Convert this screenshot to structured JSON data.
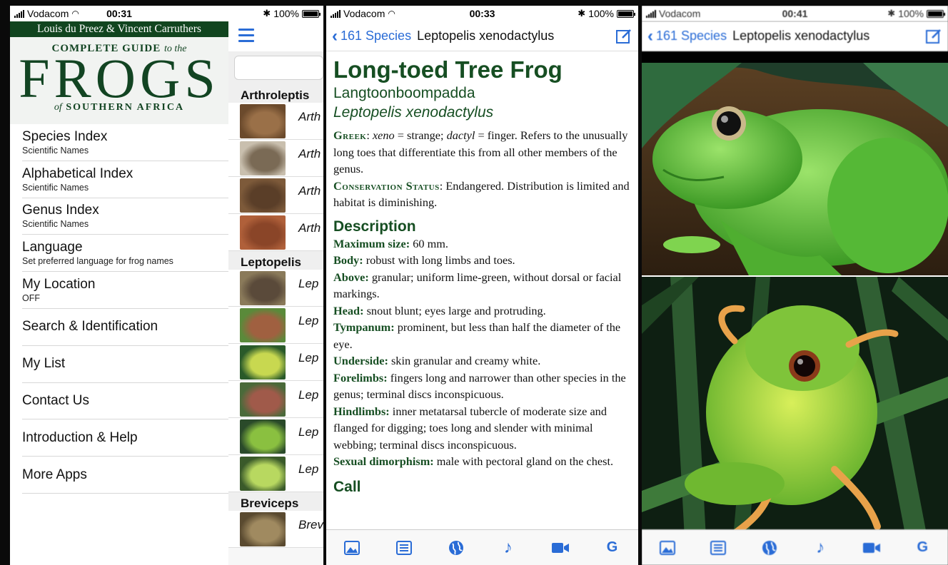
{
  "screen1": {
    "status": {
      "carrier": "Vodacom",
      "time": "00:31"
    },
    "authors": "Louis du Preez & Vincent Carruthers",
    "banner": {
      "complete_guide": "COMPLETE GUIDE",
      "to_the": "to the",
      "frogs": "FROGS",
      "of": "of",
      "southern_africa": "SOUTHERN AFRICA"
    },
    "menu": [
      {
        "title": "Species Index",
        "subtitle": "Scientific Names"
      },
      {
        "title": "Alphabetical Index",
        "subtitle": "Scientific Names"
      },
      {
        "title": "Genus Index",
        "subtitle": "Scientific Names"
      },
      {
        "title": "Language",
        "subtitle": "Set preferred language for frog names"
      },
      {
        "title": "My Location",
        "subtitle": "OFF"
      },
      {
        "title": "Search & Identification",
        "subtitle": ""
      },
      {
        "title": "My List",
        "subtitle": ""
      },
      {
        "title": "Contact Us",
        "subtitle": ""
      },
      {
        "title": "Introduction & Help",
        "subtitle": ""
      },
      {
        "title": "More Apps",
        "subtitle": ""
      }
    ]
  },
  "screen2": {
    "status": {
      "battery": "100%"
    },
    "sections": [
      {
        "header": "Arthroleptis",
        "items": [
          "Arth",
          "Arth",
          "Arth",
          "Arth"
        ]
      },
      {
        "header": "Leptopelis",
        "items": [
          "Lep",
          "Lep",
          "Lep",
          "Lep",
          "Lep",
          "Lep"
        ]
      },
      {
        "header": "Breviceps",
        "items": [
          "Brev"
        ]
      }
    ]
  },
  "screen3": {
    "status": {
      "carrier": "Vodacom",
      "time": "00:33",
      "battery": "100%"
    },
    "nav": {
      "back": "161 Species",
      "title": "Leptopelis xenodactylus"
    },
    "common_name": "Long-toed Tree Frog",
    "afrikaans_name": "Langtoonboompadda",
    "scientific_name": "Leptopelis xenodactylus",
    "greek_label": "Greek",
    "greek_text": {
      "w1": "xeno",
      "t1": " = strange; ",
      "w2": "dactyl",
      "t2": " = finger. Refers to the unusually long toes that differentiate this from all other members of the genus."
    },
    "conservation_label": "Conservation Status",
    "conservation_text": ": Endangered. Distribution is limited and habitat is diminishing.",
    "description_heading": "Description",
    "description": [
      {
        "k": "Maximum size:",
        "v": " 60 mm."
      },
      {
        "k": "Body:",
        "v": " robust with long limbs and toes."
      },
      {
        "k": "Above:",
        "v": " granular; uniform lime-green, without dorsal or facial markings."
      },
      {
        "k": "Head:",
        "v": " snout blunt; eyes large and protruding."
      },
      {
        "k": "Tympanum:",
        "v": " prominent, but less than half the diameter of the eye."
      },
      {
        "k": "Underside:",
        "v": " skin granular and creamy white."
      },
      {
        "k": "Forelimbs:",
        "v": " fingers long and narrower than other species in the genus; terminal discs inconspicuous."
      },
      {
        "k": "Hindlimbs:",
        "v": " inner metatarsal tubercle of moderate size and flanged for digging; toes long and slender with minimal webbing; terminal discs inconspicuous."
      },
      {
        "k": "Sexual dimorphism:",
        "v": " male with pectoral gland on the chest."
      }
    ],
    "call_heading": "Call",
    "tabs": {
      "g_label": "G"
    }
  },
  "screen4": {
    "status": {
      "carrier": "Vodacom",
      "time": "00:41",
      "battery": "100%"
    },
    "nav": {
      "back": "161 Species",
      "title": "Leptopelis xenodactylus"
    },
    "tabs": {
      "g_label": "G"
    }
  },
  "colors": {
    "brand_green": "#124422",
    "link_blue": "#2a6cd6",
    "frog_green": "#6cc83a"
  }
}
